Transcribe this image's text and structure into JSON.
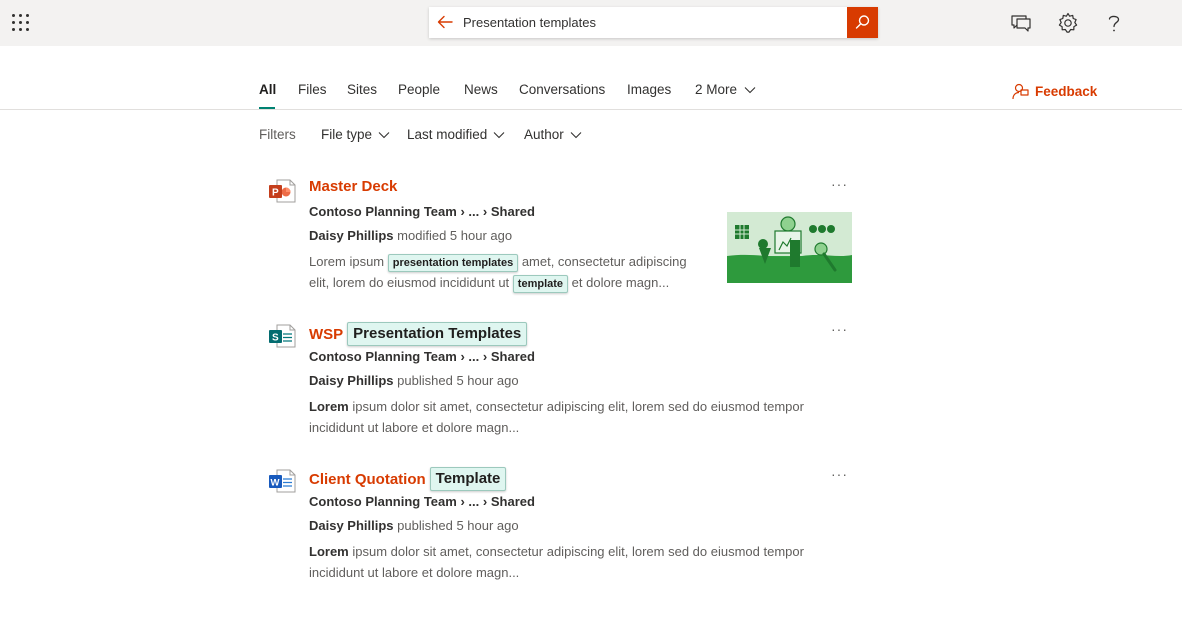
{
  "search": {
    "query": "Presentation templates"
  },
  "tabs": [
    {
      "label": "All"
    },
    {
      "label": "Files"
    },
    {
      "label": "Sites"
    },
    {
      "label": "People"
    },
    {
      "label": "News"
    },
    {
      "label": "Conversations"
    },
    {
      "label": "Images"
    },
    {
      "label": "2 More"
    }
  ],
  "feedback_label": "Feedback",
  "filters": {
    "label": "Filters",
    "items": [
      {
        "label": "File type"
      },
      {
        "label": "Last modified"
      },
      {
        "label": "Author"
      }
    ]
  },
  "results": [
    {
      "file_type": "powerpoint",
      "title": "Master Deck",
      "path_site": "Contoso Planning Team",
      "path_sep": "›",
      "path_ellipsis": "...",
      "path_folder": "Shared",
      "author_name": "Daisy Phillips",
      "action": "modified 5 hour ago",
      "snippet_pre": "Lorem ipsum",
      "snippet_hl1": "presentation templates",
      "snippet_mid1": "amet, consectetur adipiscing",
      "snippet_mid2": "elit, lorem do eiusmod incididunt ut",
      "snippet_hl2": "template",
      "snippet_post": "et dolore magn..."
    },
    {
      "file_type": "sharepoint",
      "title_plain": "WSP",
      "title_hl": "Presentation Templates",
      "path_site": "Contoso Planning Team",
      "path_ellipsis": "...",
      "path_folder": "Shared",
      "author_name": "Daisy Phillips",
      "action": "published 5 hour ago",
      "snippet_bold": "Lorem",
      "snippet_line1": "ipsum dolor sit amet, consectetur adipiscing elit, lorem sed do eiusmod tempor",
      "snippet_line2": "incididunt ut labore et dolore magn..."
    },
    {
      "file_type": "word",
      "title_plain": "Client Quotation",
      "title_hl": "Template",
      "path_site": "Contoso Planning Team",
      "path_ellipsis": "...",
      "path_folder": "Shared",
      "author_name": "Daisy Phillips",
      "action": "published 5 hour ago",
      "snippet_bold": "Lorem",
      "snippet_line1": "ipsum dolor sit amet, consectetur adipiscing elit, lorem sed do eiusmod tempor",
      "snippet_line2": "incididunt ut labore et dolore magn..."
    }
  ],
  "more_label": "···",
  "icons": {
    "waffle": "app-launcher-icon",
    "back": "arrow-left-icon",
    "search": "search-icon",
    "chat": "chat-icon",
    "settings": "gear-icon",
    "help": "help-icon",
    "feedback": "feedback-icon",
    "chevron": "chevron-down-icon"
  },
  "colors": {
    "accent": "#d83b01",
    "tab_underline": "#008272",
    "highlight_bg": "#dff6f0",
    "thumbnail_green": "#33a343"
  }
}
